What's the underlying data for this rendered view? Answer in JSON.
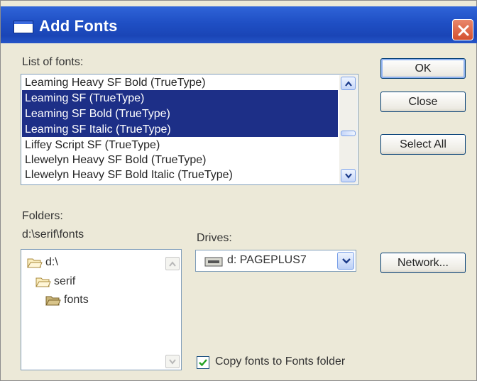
{
  "window": {
    "title": "Add Fonts"
  },
  "font_list": {
    "label": "List of fonts:",
    "items": [
      "Leaming Heavy SF Bold (TrueType)",
      "Leaming SF (TrueType)",
      "Leaming SF Bold (TrueType)",
      "Leaming SF Italic (TrueType)",
      "Liffey Script SF (TrueType)",
      "Llewelyn Heavy SF Bold (TrueType)",
      "Llewelyn Heavy SF Bold Italic (TrueType)"
    ],
    "selected_indices": [
      1,
      2,
      3
    ]
  },
  "buttons": {
    "ok": "OK",
    "close": "Close",
    "select_all": "Select All",
    "network": "Network..."
  },
  "folders": {
    "label": "Folders:",
    "current_path": "d:\\serif\\fonts",
    "tree": [
      "d:\\",
      "serif",
      "fonts"
    ]
  },
  "drives": {
    "label": "Drives:",
    "selected": "d: PAGEPLUS7"
  },
  "copy_option": {
    "label": "Copy fonts to Fonts folder",
    "checked": true
  },
  "colors": {
    "title_bar": "#1f4fc4",
    "selection": "#1d2f87",
    "dialog_bg": "#ece9d8"
  },
  "icons": [
    "window-icon",
    "close-icon",
    "folder-icon",
    "drive-icon",
    "checkmark-icon",
    "scroll-arrow-icon"
  ]
}
